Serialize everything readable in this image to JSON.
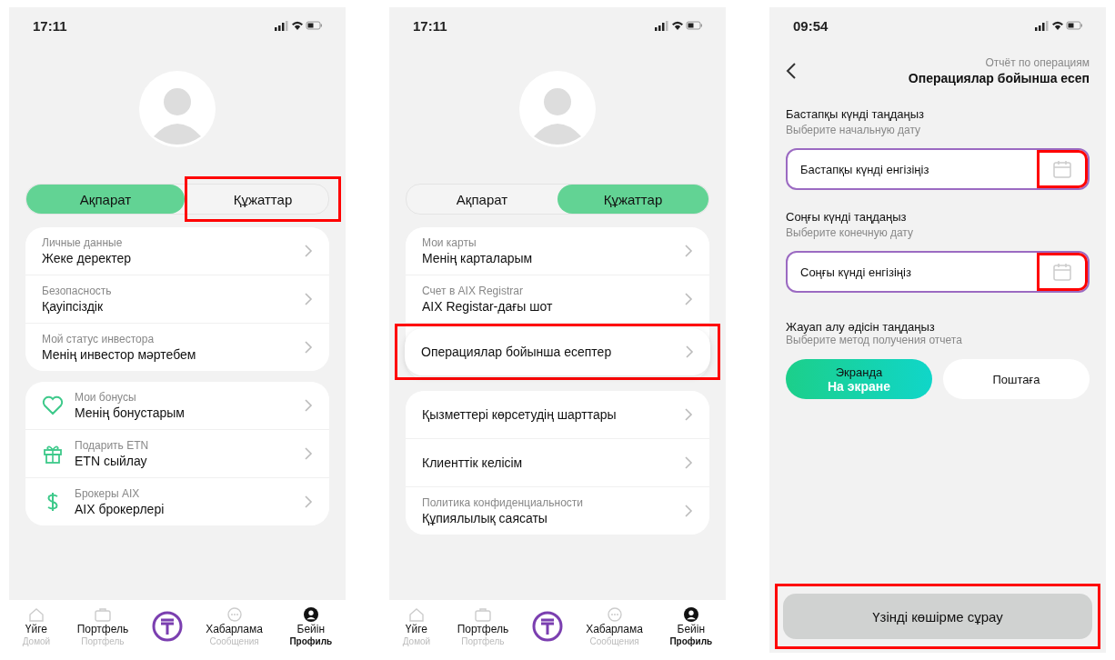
{
  "phones": [
    {
      "kind": "profile",
      "time": "17:11",
      "tabs": [
        {
          "label": "Ақпарат",
          "selected": true,
          "highlighted": false
        },
        {
          "label": "Құжаттар",
          "selected": false,
          "highlighted": true
        }
      ],
      "groups": [
        [
          {
            "kind": "plain",
            "ru": "Личные данные",
            "kk": "Жеке деректер",
            "highlighted": false
          },
          {
            "kind": "plain",
            "ru": "Безопасность",
            "kk": "Қауіпсіздік",
            "highlighted": false
          },
          {
            "kind": "plain",
            "ru": "Мой статус инвестора",
            "kk": "Менің инвестор мәртебем",
            "highlighted": false
          }
        ],
        [
          {
            "kind": "icon",
            "ru": "Мои бонусы",
            "kk": "Менің бонустарым",
            "highlighted": false
          },
          {
            "kind": "icon",
            "ru": "Подарить ETN",
            "kk": "ETN сыйлау",
            "highlighted": false
          },
          {
            "kind": "icon",
            "ru": "Брокеры AIX",
            "kk": "AIX брокерлері",
            "highlighted": false
          }
        ]
      ],
      "nav": [
        {
          "kind": "item",
          "kk": "Үйге",
          "ru": "Домой",
          "selected": false
        },
        {
          "kind": "item",
          "kk": "Портфель",
          "ru": "Портфель",
          "selected": false
        },
        {
          "kind": "center"
        },
        {
          "kind": "item",
          "kk": "Хабарлама",
          "ru": "Сообщения",
          "selected": false
        },
        {
          "kind": "item",
          "kk": "Бейін",
          "ru": "Профиль",
          "selected": true
        }
      ]
    },
    {
      "kind": "profile",
      "time": "17:11",
      "tabs": [
        {
          "label": "Ақпарат",
          "selected": false,
          "highlighted": false
        },
        {
          "label": "Құжаттар",
          "selected": true,
          "highlighted": false
        }
      ],
      "groups": [
        [
          {
            "kind": "plain",
            "ru": "Мои карты",
            "kk": "Менің карталарым",
            "highlighted": false
          },
          {
            "kind": "plain",
            "ru": "Счет в AIX Registrar",
            "kk": "AIX Registar-дағы шот",
            "highlighted": false
          },
          {
            "kind": "plain",
            "kk": "Операциялар бойынша есептер",
            "highlighted": true
          }
        ],
        [
          {
            "kind": "plain",
            "kk": "Қызметтері көрсетудің шарттары",
            "highlighted": false
          },
          {
            "kind": "plain",
            "kk": "Клиенттік келісім",
            "highlighted": false
          },
          {
            "kind": "plain",
            "ru": "Политика конфиденциальности",
            "kk": "Құпиялылық саясаты",
            "highlighted": false
          }
        ]
      ],
      "nav": [
        {
          "kind": "item",
          "kk": "Үйге",
          "ru": "Домой",
          "selected": false
        },
        {
          "kind": "item",
          "kk": "Портфель",
          "ru": "Портфель",
          "selected": false
        },
        {
          "kind": "center"
        },
        {
          "kind": "item",
          "kk": "Хабарлама",
          "ru": "Сообщения",
          "selected": false
        },
        {
          "kind": "item",
          "kk": "Бейін",
          "ru": "Профиль",
          "selected": true
        }
      ]
    },
    {
      "kind": "report",
      "time": "09:54",
      "title_ru": "Отчёт по операциям",
      "title_kk": "Операциялар бойынша есеп",
      "fields": [
        {
          "label_kk": "Бастапқы күнді таңдаңыз",
          "label_ru": "Выберите начальную дату",
          "placeholder": "Бастапқы күнді енгізіңіз",
          "highlighted": true
        },
        {
          "label_kk": "Соңғы күнді таңдаңыз",
          "label_ru": "Выберите конечную дату",
          "placeholder": "Соңғы күнді енгізіңіз",
          "highlighted": true
        }
      ],
      "method_kk": "Жауап алу әдісін таңдаңыз",
      "method_ru": "Выберите метод получения отчета",
      "options": [
        {
          "kk": "Экранда",
          "ru": "На экране",
          "selected": true
        },
        {
          "kk": "Поштаға",
          "selected": false
        }
      ],
      "submit": {
        "label": "Үзінді көшірме сұрау",
        "disabled": true,
        "highlighted": true
      }
    }
  ]
}
